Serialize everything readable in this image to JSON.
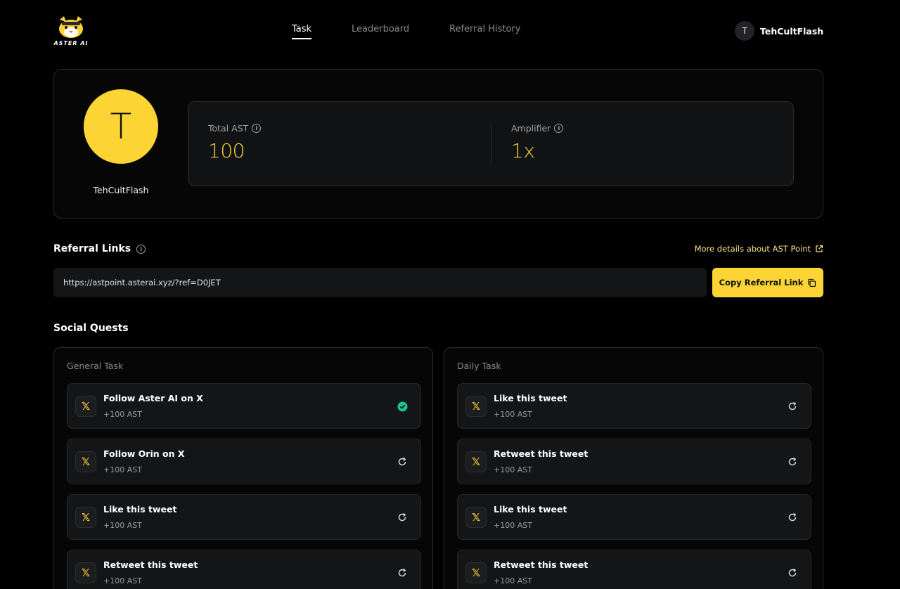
{
  "brand": {
    "logo_text": "ASTER AI"
  },
  "nav": {
    "items": [
      "Task",
      "Leaderboard",
      "Referral History"
    ],
    "active": 0
  },
  "user": {
    "initial": "T",
    "name": "TehCultFlash"
  },
  "profile": {
    "initial": "T",
    "name": "TehCultFlash",
    "stats": [
      {
        "label": "Total AST",
        "value": "100"
      },
      {
        "label": "Amplifier",
        "value": "1x"
      }
    ]
  },
  "referral": {
    "title": "Referral Links",
    "more_link": "More details about AST Point",
    "url": "https://astpoint.asterai.xyz/?ref=D0JET",
    "copy_label": "Copy Referral Link"
  },
  "social": {
    "title": "Social Quests",
    "general": {
      "title": "General Task",
      "tasks": [
        {
          "title": "Follow Aster AI on X",
          "reward": "+100 AST",
          "status": "done"
        },
        {
          "title": "Follow Orin on X",
          "reward": "+100 AST",
          "status": "refresh"
        },
        {
          "title": "Like this tweet",
          "reward": "+100 AST",
          "status": "refresh"
        },
        {
          "title": "Retweet this tweet",
          "reward": "+100 AST",
          "status": "refresh"
        }
      ]
    },
    "daily": {
      "title": "Daily Task",
      "tasks": [
        {
          "title": "Like this tweet",
          "reward": "+100 AST",
          "status": "refresh"
        },
        {
          "title": "Retweet this tweet",
          "reward": "+100 AST",
          "status": "refresh"
        },
        {
          "title": "Like this tweet",
          "reward": "+100 AST",
          "status": "refresh"
        },
        {
          "title": "Retweet this tweet",
          "reward": "+100 AST",
          "status": "refresh"
        }
      ]
    }
  },
  "icons": {
    "x": "x-logo-icon",
    "done": "check-circle-icon",
    "refresh": "refresh-icon",
    "info": "info-icon",
    "external": "external-link-icon",
    "copy": "copy-icon"
  },
  "colors": {
    "accent": "#fcd535",
    "done": "#1fbf8f",
    "background": "#000000"
  }
}
